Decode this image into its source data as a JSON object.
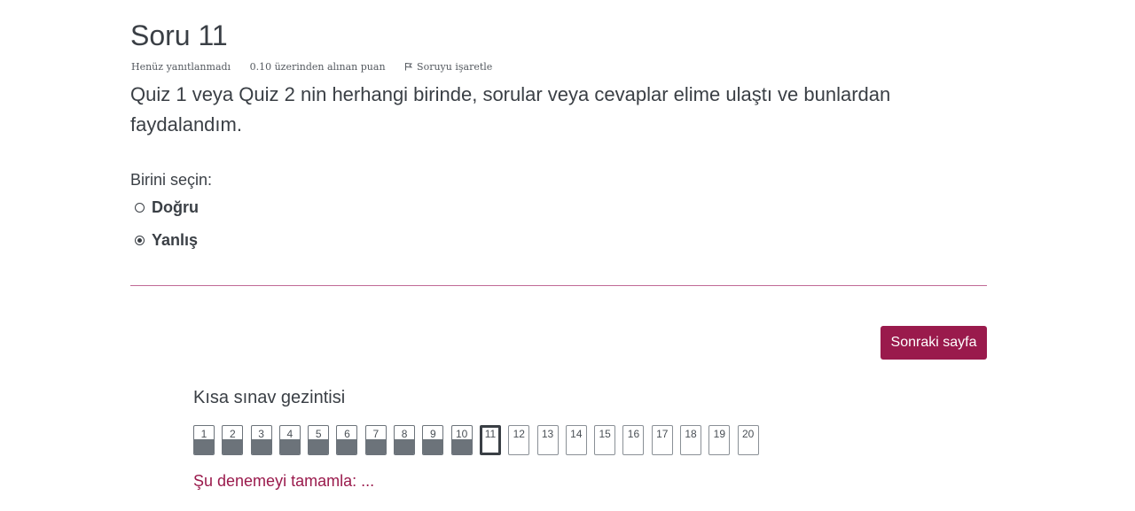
{
  "question": {
    "title": "Soru 11",
    "status": "Henüz yanıtlanmadı",
    "points": "0.10 üzerinden alınan puan",
    "flag_label": "Soruyu işaretle",
    "text": "Quiz 1 veya Quiz 2 nin herhangi birinde, sorular veya cevaplar elime ulaştı ve bunlardan faydalandım.",
    "prompt": "Birini seçin:",
    "options": [
      {
        "label": "Doğru",
        "selected": false
      },
      {
        "label": "Yanlış",
        "selected": true
      }
    ]
  },
  "next_button": "Sonraki sayfa",
  "navigation": {
    "title": "Kısa sınav gezintisi",
    "buttons": [
      {
        "label": "1",
        "state": "answered"
      },
      {
        "label": "2",
        "state": "answered"
      },
      {
        "label": "3",
        "state": "answered"
      },
      {
        "label": "4",
        "state": "answered"
      },
      {
        "label": "5",
        "state": "answered"
      },
      {
        "label": "6",
        "state": "answered"
      },
      {
        "label": "7",
        "state": "answered"
      },
      {
        "label": "8",
        "state": "answered"
      },
      {
        "label": "9",
        "state": "answered"
      },
      {
        "label": "10",
        "state": "answered"
      },
      {
        "label": "11",
        "state": "current"
      },
      {
        "label": "12",
        "state": "empty"
      },
      {
        "label": "13",
        "state": "empty"
      },
      {
        "label": "14",
        "state": "empty"
      },
      {
        "label": "15",
        "state": "empty"
      },
      {
        "label": "16",
        "state": "empty"
      },
      {
        "label": "17",
        "state": "empty"
      },
      {
        "label": "18",
        "state": "empty"
      },
      {
        "label": "19",
        "state": "empty"
      },
      {
        "label": "20",
        "state": "empty"
      }
    ],
    "finish_link": "Şu denemeyi tamamla: ..."
  },
  "colors": {
    "accent": "#9a1a4c",
    "divider": "#c06a95",
    "answered_fill": "#6c737a"
  }
}
